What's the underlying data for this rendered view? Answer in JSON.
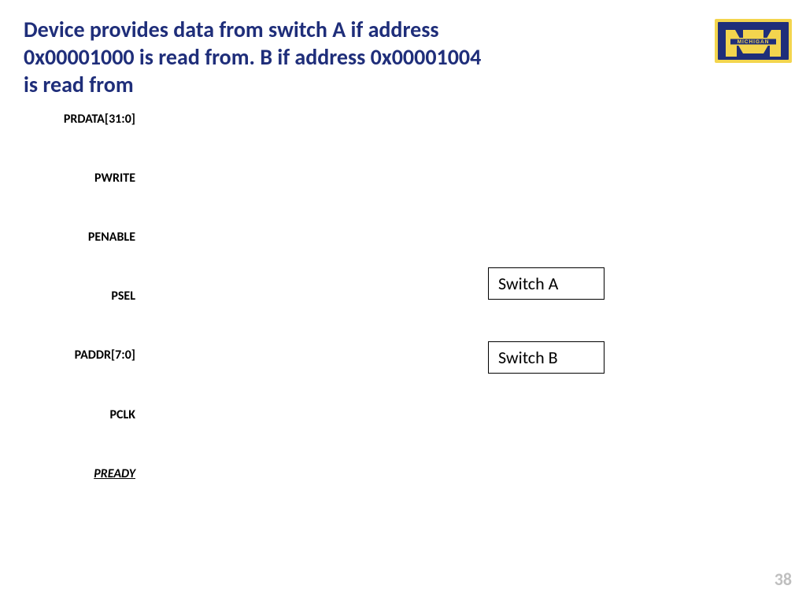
{
  "title": "Device provides data from switch A if address 0x00001000 is read from. B if address 0x00001004 is read from",
  "logo": {
    "text_top": "MICHIGAN",
    "brand_color": "#1f2e7a",
    "accent_color": "#f3d54e"
  },
  "signals": {
    "prdata": "PRDATA[31:0]",
    "pwrite": "PWRITE",
    "penable": "PENABLE",
    "psel": "PSEL",
    "paddr": "PADDR[7:0]",
    "pclk": "PCLK",
    "pready": "PREADY"
  },
  "switches": {
    "a": "Switch A",
    "b": "Switch B"
  },
  "page_number": "38"
}
